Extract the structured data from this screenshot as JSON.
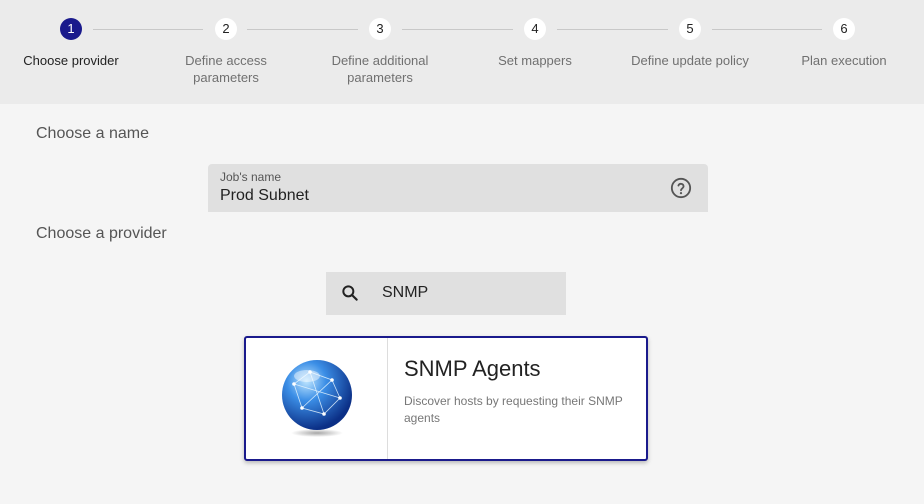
{
  "stepper": {
    "steps": [
      {
        "number": "1",
        "label": "Choose provider",
        "active": true
      },
      {
        "number": "2",
        "label": "Define access\nparameters",
        "active": false
      },
      {
        "number": "3",
        "label": "Define additional\nparameters",
        "active": false
      },
      {
        "number": "4",
        "label": "Set mappers",
        "active": false
      },
      {
        "number": "5",
        "label": "Define update policy",
        "active": false
      },
      {
        "number": "6",
        "label": "Plan execution",
        "active": false
      }
    ],
    "active_color": "#1a1a8c"
  },
  "name_section": {
    "title": "Choose a name",
    "field_label": "Job's name",
    "field_value": "Prod Subnet",
    "help_icon": "help-circle-icon"
  },
  "provider_section": {
    "title": "Choose a provider",
    "search_icon": "search-icon",
    "search_value": "SNMP"
  },
  "provider_card": {
    "icon": "globe-network-icon",
    "title": "SNMP Agents",
    "description": "Discover hosts by requesting their SNMP agents",
    "selected": true
  }
}
